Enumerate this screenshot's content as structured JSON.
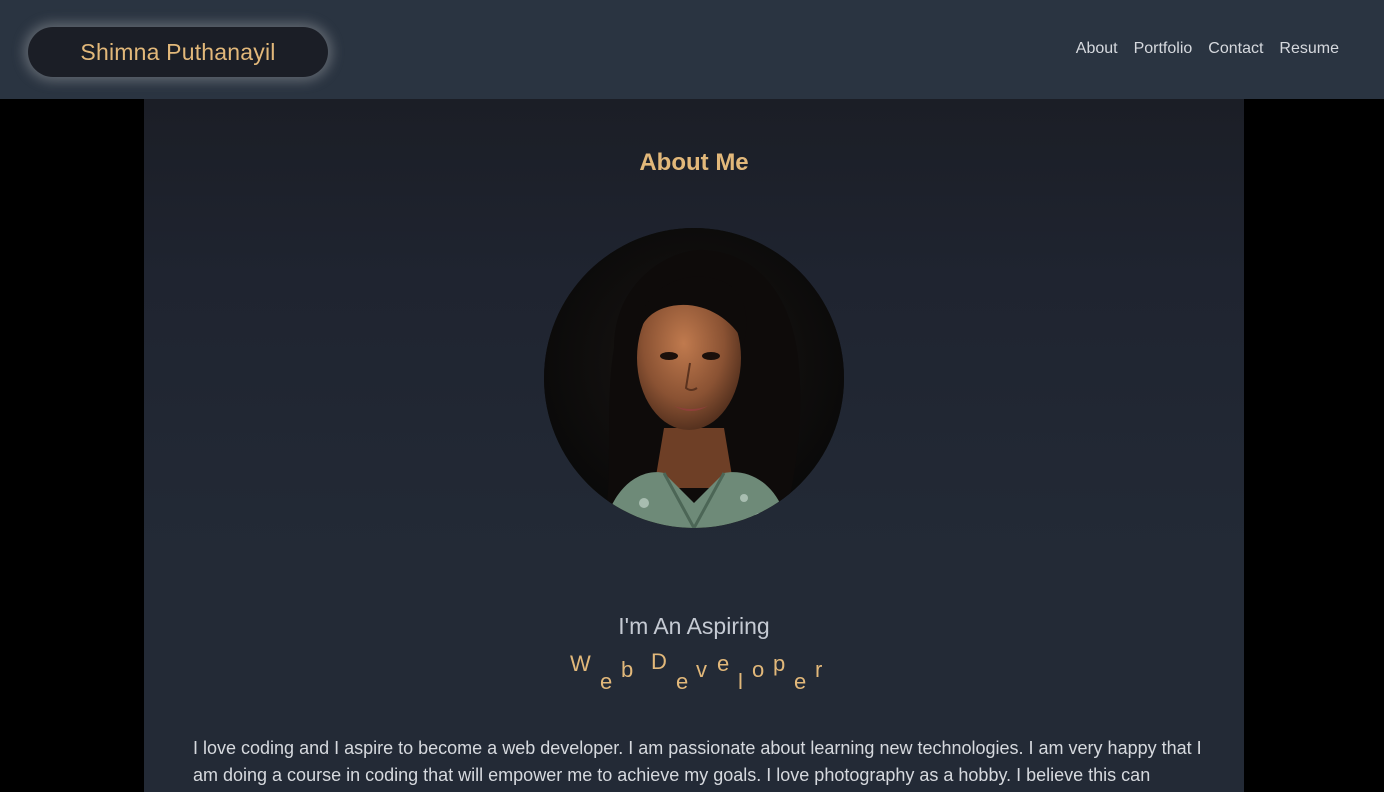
{
  "header": {
    "brand": "Shimna Puthanayil",
    "nav": [
      "About",
      "Portfolio",
      "Contact",
      "Resume"
    ]
  },
  "about": {
    "title": "About Me",
    "photo_alt": "Portrait of Shimna Puthanayil",
    "subtitle": "I'm An Aspiring",
    "role_letters": [
      "W",
      "e",
      "b",
      "D",
      "e",
      "v",
      "e",
      "l",
      "o",
      "p",
      "e",
      "r"
    ],
    "bio": "I love coding and I aspire to become a web developer. I am passionate about learning new technologies. I am very happy that I am doing a course in coding that will empower me to achieve my goals. I love photography as a hobby. I believe this can"
  },
  "colors": {
    "accent": "#e2b87a",
    "header_bg": "#2a3441",
    "panel_bg": "#232a36",
    "text": "#d6d9de"
  }
}
